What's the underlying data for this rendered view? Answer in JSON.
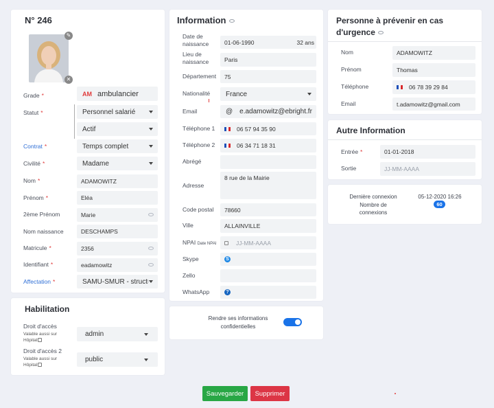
{
  "profile": {
    "title": "N° 246",
    "grade_label": "Grade",
    "grade_badge": "AM",
    "grade_value": "ambulancier",
    "statut_label": "Statut",
    "statut_value": "Personnel salarié",
    "statut_value2": "Actif",
    "contrat_label": "Contrat",
    "contrat_value": "Temps complet",
    "civilite_label": "Civilité",
    "civilite_value": "Madame",
    "nom_label": "Nom",
    "nom_value": "ADAMOWITZ",
    "prenom_label": "Prénom",
    "prenom_value": "Eléa",
    "prenom2_label": "2ème Prénom",
    "prenom2_value": "Marie",
    "nom_naissance_label": "Nom naissance",
    "nom_naissance_value": "DESCHAMPS",
    "matricule_label": "Matricule",
    "matricule_value": "2356",
    "identifiant_label": "Identifiant",
    "identifiant_value": "eadamowitz",
    "affectation_label": "Affectation",
    "affectation_value": "SAMU-SMUR - structure"
  },
  "habilitation": {
    "title": "Habilitation",
    "droit1_label": "Droit d'accès",
    "droit1_sub": "Valable aussi sur Hôpital",
    "droit1_value": "admin",
    "droit2_label": "Droit d'accès 2",
    "droit2_sub": "Valable aussi sur Hôpital",
    "droit2_value": "public"
  },
  "information": {
    "title": "Information",
    "dob_label": "Date de naissance",
    "dob_value": "01-06-1990",
    "age": "32 ans",
    "lieu_label": "Lieu de naissance",
    "lieu_value": "Paris",
    "departement_label": "Département",
    "departement_value": "75",
    "nationalite_label": "Nationalité",
    "nationalite_value": "France",
    "email_label": "Email",
    "email_value": "e.adamowitz@ebright.fr",
    "tel1_label": "Téléphone 1",
    "tel1_value": "06 57 94 35 90",
    "tel2_label": "Téléphone 2",
    "tel2_value": "06 34 71 18 31",
    "abrege_label": "Abrégé",
    "abrege_value": "",
    "adresse_label": "Adresse",
    "adresse_value": "8 rue de la Mairie",
    "cp_label": "Code postal",
    "cp_value": "78660",
    "ville_label": "Ville",
    "ville_value": "ALLAINVILLE",
    "npai_label": "NPAI",
    "npai_sub": "Date NPAI",
    "npai_placeholder": "JJ-MM-AAAA",
    "skype_label": "Skype",
    "zello_label": "Zello",
    "whatsapp_label": "WhatsApp",
    "confidential_label": "Rendre ses informations confidentielles",
    "confidential_on": true
  },
  "urgence": {
    "title": "Personne à prévenir en cas d'urgence",
    "nom_label": "Nom",
    "nom_value": "ADAMOWITZ",
    "prenom_label": "Prénom",
    "prenom_value": "Thomas",
    "tel_label": "Téléphone",
    "tel_value": "06 78 39 29 84",
    "email_label": "Email",
    "email_value": "t.adamowitz@gmail.com"
  },
  "autre": {
    "title": "Autre Information",
    "entree_label": "Entrée",
    "entree_value": "01-01-2018",
    "sortie_label": "Sortie",
    "sortie_placeholder": "JJ-MM-AAAA"
  },
  "connexion": {
    "last_label": "Dernière connexion",
    "last_value": "05-12-2020 16:26",
    "count_label": "Nombre de connexions",
    "count_value": "60"
  },
  "actions": {
    "save_label": "Sauvegarder",
    "delete_label": "Supprimer"
  },
  "colors": {
    "save": "#28a745",
    "delete": "#dc3545",
    "link": "#2f6fd6",
    "toggle": "#1a73e8"
  }
}
